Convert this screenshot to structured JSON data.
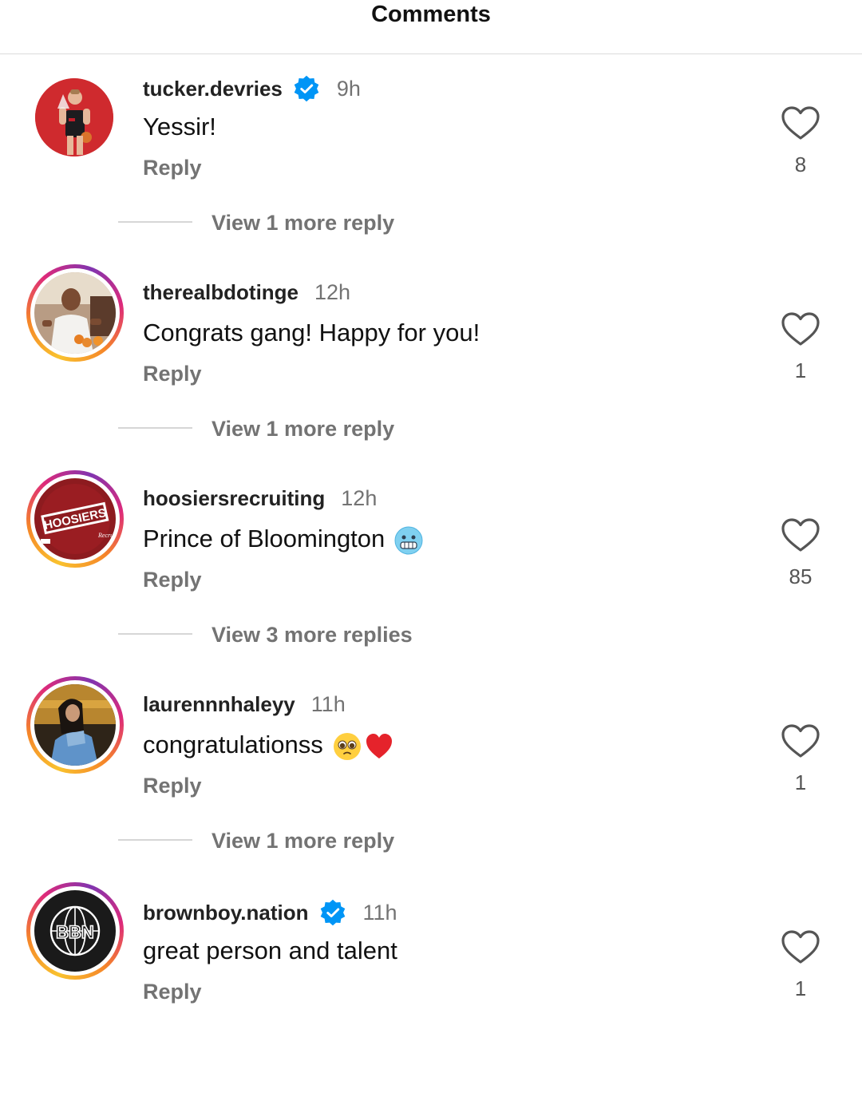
{
  "header": {
    "title": "Comments"
  },
  "comments": [
    {
      "username": "tucker.devries",
      "verified": true,
      "time": "9h",
      "text": "Yessir!",
      "emojis": [],
      "reply_label": "Reply",
      "likes": "8",
      "view_more": "View 1 more reply",
      "avatar": "basketball-player-photo",
      "story_ring": false
    },
    {
      "username": "therealbdotinge",
      "verified": false,
      "time": "12h",
      "text": "Congrats gang! Happy for you!",
      "emojis": [],
      "reply_label": "Reply",
      "likes": "1",
      "view_more": "View 1 more reply",
      "avatar": "man-photo",
      "story_ring": true
    },
    {
      "username": "hoosiersrecruiting",
      "verified": false,
      "time": "12h",
      "text": "Prince of Bloomington",
      "emojis": [
        "cold-face-emoji"
      ],
      "reply_label": "Reply",
      "likes": "85",
      "view_more": "View 3 more replies",
      "avatar": "hoosiers-logo",
      "avatar_text": "HOOSIERS",
      "story_ring": true
    },
    {
      "username": "laurennnhaleyy",
      "verified": false,
      "time": "11h",
      "text": "congratulationss",
      "emojis": [
        "pleading-face-emoji",
        "red-heart-emoji"
      ],
      "reply_label": "Reply",
      "likes": "1",
      "view_more": "View 1 more reply",
      "avatar": "woman-photo",
      "story_ring": true
    },
    {
      "username": "brownboy.nation",
      "verified": true,
      "time": "11h",
      "text": "great person and talent",
      "emojis": [],
      "reply_label": "Reply",
      "likes": "1",
      "view_more": "",
      "avatar": "bbn-logo",
      "avatar_text": "BBN",
      "story_ring": true
    }
  ],
  "colors": {
    "verified": "#0095f6",
    "muted": "#737373",
    "ring_start": "#f9c22e",
    "ring_end": "#dd2a7b"
  }
}
